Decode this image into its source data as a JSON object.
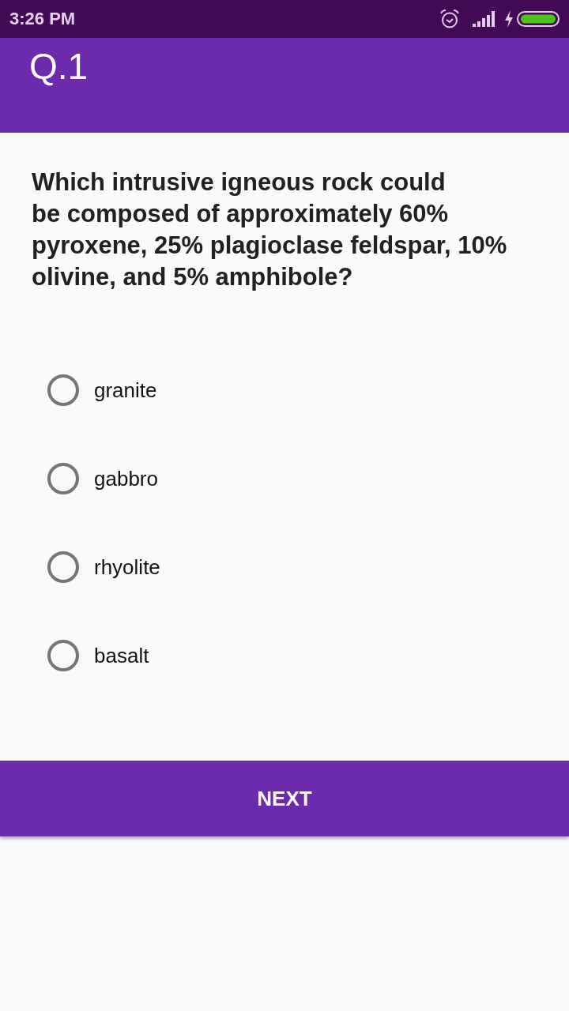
{
  "status_bar": {
    "time": "3:26 PM"
  },
  "app_bar": {
    "title": "Q.1"
  },
  "question": {
    "text": "Which intrusive igneous rock could\nbe composed of approximately 60% pyroxene, 25% plagioclase feldspar, 10% olivine, and 5% amphibole?"
  },
  "options": [
    {
      "label": "granite",
      "selected": false
    },
    {
      "label": "gabbro",
      "selected": false
    },
    {
      "label": "rhyolite",
      "selected": false
    },
    {
      "label": "basalt",
      "selected": false
    }
  ],
  "next_button": {
    "label": "NEXT"
  }
}
